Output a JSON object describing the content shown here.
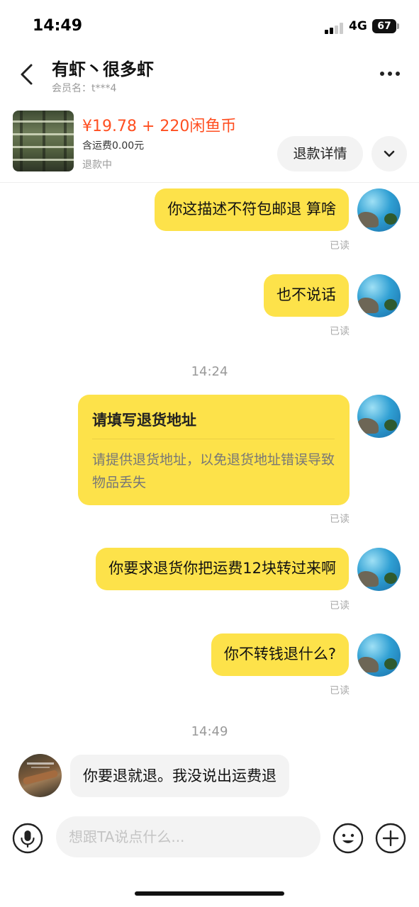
{
  "status_bar": {
    "time": "14:49",
    "network": "4G",
    "battery": "67"
  },
  "header": {
    "title": "有虾丶很多虾",
    "subtitle": "会员名：t***4"
  },
  "product": {
    "price": "¥19.78 + 220闲鱼币",
    "shipping": "含运费0.00元",
    "status": "退款中",
    "refund_button": "退款详情"
  },
  "messages": [
    {
      "text": "你这描述不符包邮退 算啥",
      "read": "已读"
    },
    {
      "text": "也不说话",
      "read": "已读"
    },
    {
      "timestamp": "14:24"
    },
    {
      "card_title": "请填写退货地址",
      "card_body": "请提供退货地址，以免退货地址错误导致物品丢失",
      "read": "已读"
    },
    {
      "text": "你要求退货你把运费12块转过来啊",
      "read": "已读"
    },
    {
      "text": "你不转钱退什么?",
      "read": "已读"
    },
    {
      "timestamp": "14:49"
    },
    {
      "text": "你要退就退。我没说出运费退"
    }
  ],
  "input": {
    "placeholder": "想跟TA说点什么..."
  },
  "icons": {
    "back": "chevron-left-icon",
    "more": "more-icon",
    "expand": "chevron-down-icon",
    "mic": "microphone-icon",
    "emoji": "emoji-icon",
    "plus": "plus-icon"
  },
  "colors": {
    "price": "#ff4f21",
    "bubble_self": "#fde24a",
    "bubble_other": "#f3f3f3"
  }
}
